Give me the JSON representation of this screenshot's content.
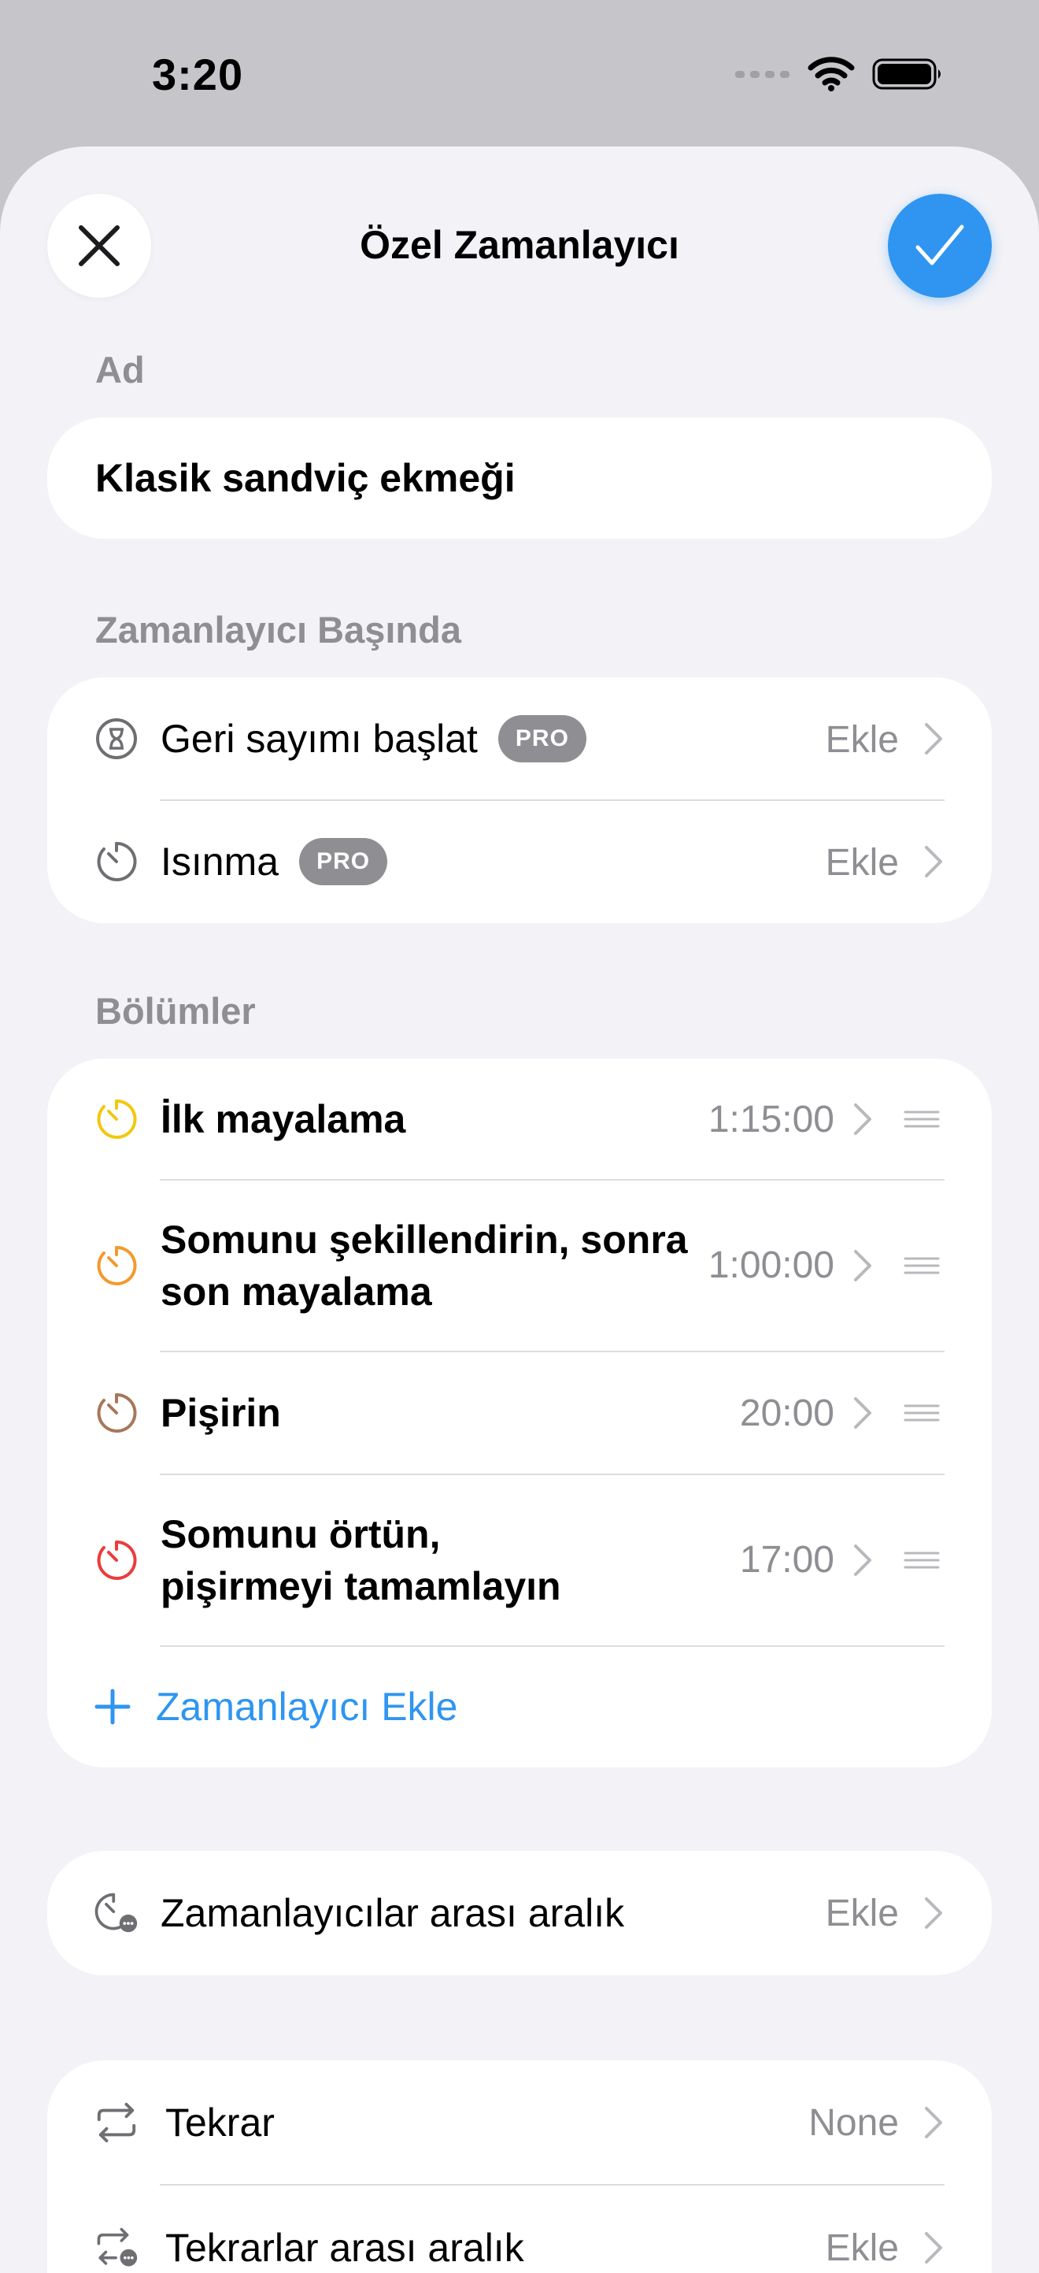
{
  "status_bar": {
    "time": "3:20"
  },
  "sheet": {
    "title": "Özel Zamanlayıcı"
  },
  "name_section": {
    "label": "Ad",
    "value": "Klasik sandviç ekmeği"
  },
  "start_section": {
    "label": "Zamanlayıcı Başında",
    "rows": [
      {
        "label": "Geri sayımı başlat",
        "badge": "PRO",
        "value": "Ekle",
        "icon": "hourglass-icon"
      },
      {
        "label": "Isınma",
        "badge": "PRO",
        "value": "Ekle",
        "icon": "timer-icon"
      }
    ]
  },
  "sections": {
    "label": "Bölümler",
    "items": [
      {
        "line1": "İlk mayalama",
        "line2": "",
        "duration": "1:15:00",
        "color": "#f2c80f"
      },
      {
        "line1": "Somunu şekillendirin, sonra",
        "line2": "son mayalama",
        "duration": "1:00:00",
        "color": "#f39a2c"
      },
      {
        "line1": "Pişirin",
        "line2": "",
        "duration": "20:00",
        "color": "#a8775a"
      },
      {
        "line1": "Somunu örtün,",
        "line2": "pişirmeyi tamamlayın",
        "duration": "17:00",
        "color": "#ec3b3b"
      }
    ],
    "add_label": "Zamanlayıcı Ekle"
  },
  "interval_section": {
    "label": "Zamanlayıcılar arası aralık",
    "value": "Ekle"
  },
  "repeat_section": {
    "rows": [
      {
        "label": "Tekrar",
        "value": "None"
      },
      {
        "label": "Tekrarlar arası aralık",
        "value": "Ekle"
      }
    ]
  },
  "colors": {
    "accent": "#2f95f0",
    "secondary_text": "#8e8e93"
  }
}
